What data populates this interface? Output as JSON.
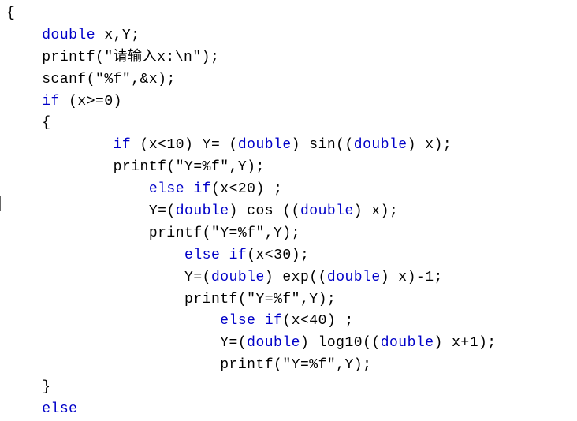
{
  "code": {
    "kw_double": "double",
    "kw_if": "if",
    "kw_else": "else",
    "t_brace_open": "{",
    "t_brace_close": "}",
    "l0_decl_vars": " x,Y;",
    "l1": "printf(\"请输入x:\\n\");",
    "l2": "scanf(\"%f\",&x);",
    "l3_cond": " (x>=0)",
    "l5_a": " (x<10) Y= (",
    "l5_b": ") sin((",
    "l5_c": ") x);",
    "l6": "printf(\"Y=%f\",Y);",
    "l7_a": " ",
    "l7_b": "(x<20) ;",
    "l8_a": "Y=(",
    "l8_b": ") cos ((",
    "l8_c": ") x);",
    "l9": "printf(\"Y=%f\",Y);",
    "l10_a": " ",
    "l10_b": "(x<30);",
    "l11_a": "Y=(",
    "l11_b": ") exp((",
    "l11_c": ") x)-1;",
    "l12": "printf(\"Y=%f\",Y);",
    "l13_a": " ",
    "l13_b": "(x<40) ;",
    "l14_a": "Y=(",
    "l14_b": ") log10((",
    "l14_c": ") x+1);",
    "l15": "printf(\"Y=%f\",Y);"
  }
}
